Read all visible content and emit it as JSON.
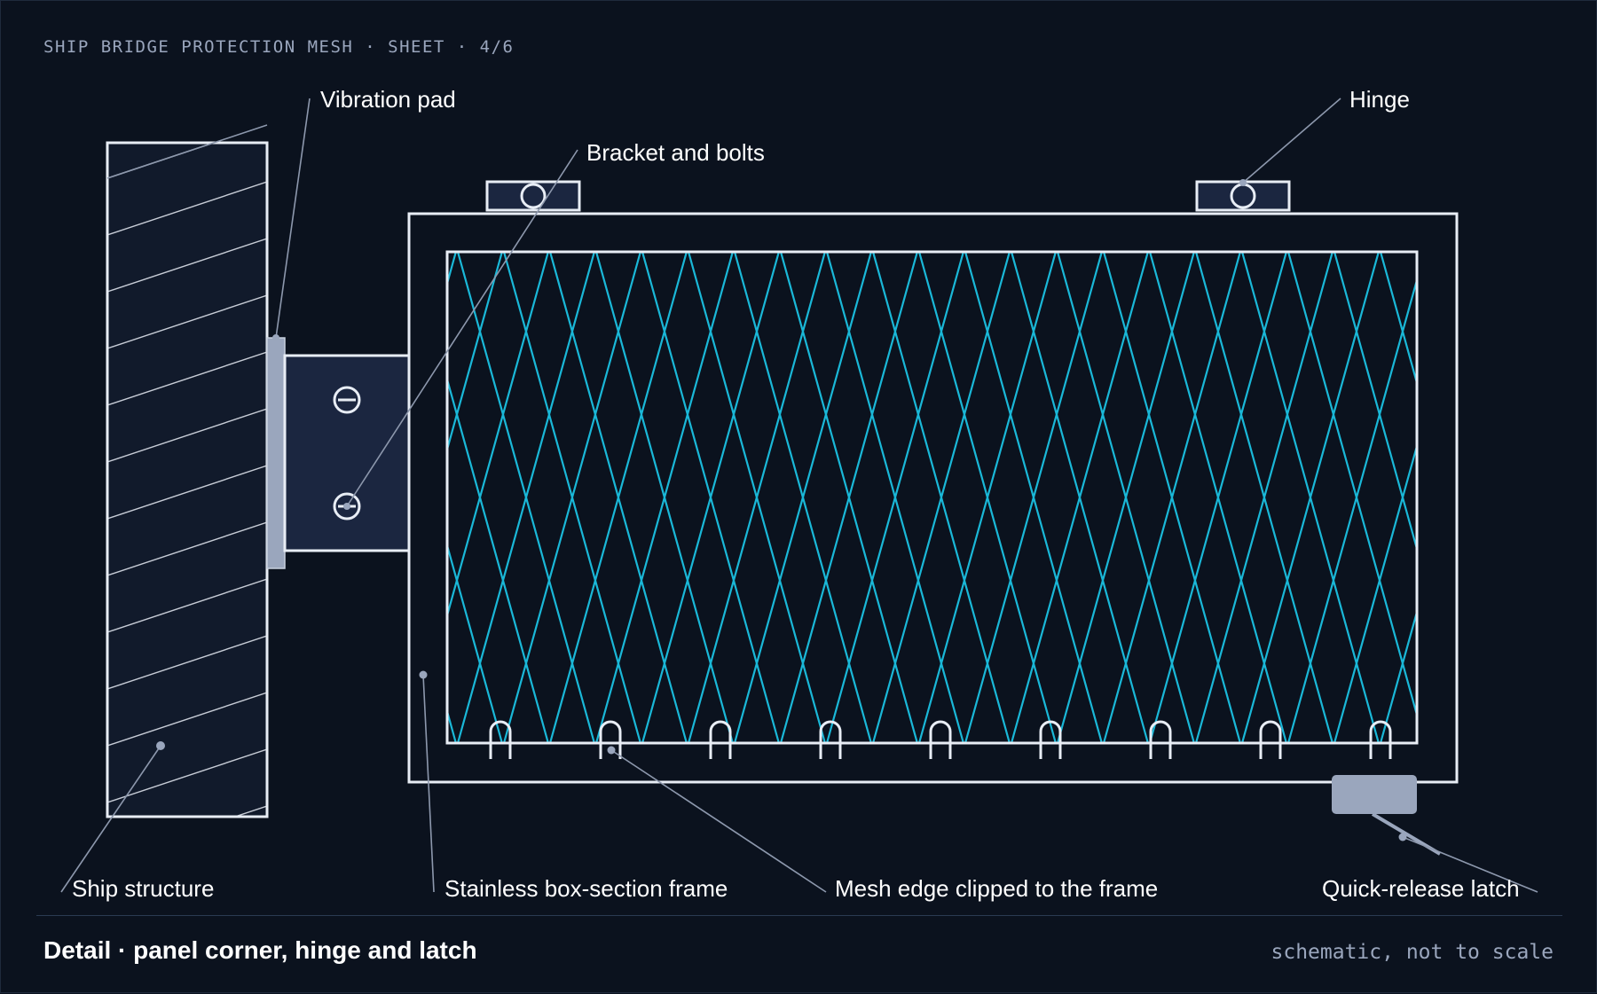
{
  "sheet": {
    "id_label": "SHIP BRIDGE PROTECTION MESH · SHEET · 4/6"
  },
  "labels": {
    "vibration_pad": "Vibration pad",
    "hinge": "Hinge",
    "bracket_and_bolts": "Bracket and bolts",
    "ship_structure": "Ship structure",
    "frame": "Stainless box-section frame",
    "mesh_edge": "Mesh edge clipped to the frame",
    "latch": "Quick-release latch"
  },
  "footer": {
    "title": "Detail · panel corner, hinge and latch",
    "note": "schematic, not to scale"
  },
  "colors": {
    "background": "#0b121e",
    "line": "#e8edf5",
    "mesh": "#1ab8d8",
    "fill_dark": "#1b2640",
    "pad": "#9aa6bd",
    "leader": "#8d98ad"
  }
}
